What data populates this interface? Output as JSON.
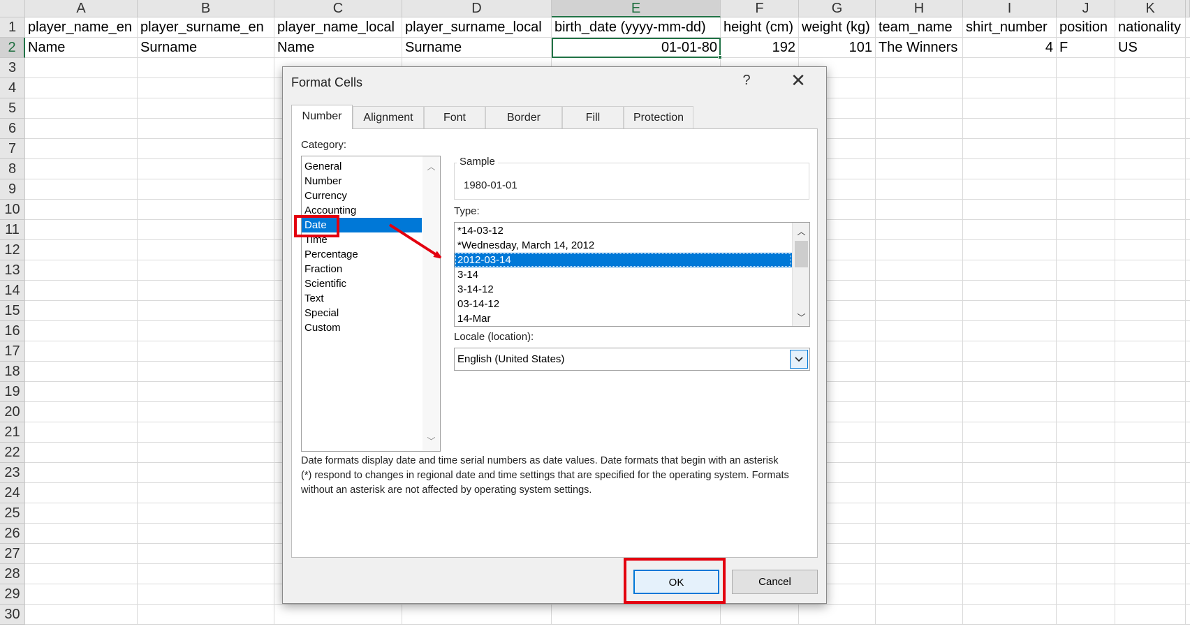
{
  "sheet": {
    "columns": [
      "A",
      "B",
      "C",
      "D",
      "E",
      "F",
      "G",
      "H",
      "I",
      "J",
      "K"
    ],
    "rows": [
      "1",
      "2",
      "3",
      "4",
      "5",
      "6",
      "7",
      "8",
      "9",
      "10",
      "11",
      "12",
      "13",
      "14",
      "15",
      "16",
      "17",
      "18",
      "19",
      "20",
      "21",
      "22",
      "23",
      "24",
      "25",
      "26",
      "27",
      "28",
      "29",
      "30"
    ],
    "header_row": [
      "player_name_en",
      "player_surname_en",
      "player_name_local",
      "player_surname_local",
      "birth_date (yyyy-mm-dd)",
      "height (cm)",
      "weight (kg)",
      "team_name",
      "shirt_number",
      "position",
      "nationality"
    ],
    "data_row": [
      "Name",
      "Surname",
      "Name",
      "Surname",
      "01-01-80",
      "192",
      "101",
      "The Winners",
      "4",
      "F",
      "US"
    ],
    "selected_column": "E",
    "selected_row": "2",
    "accent_color": "#217346"
  },
  "dialog": {
    "title": "Format Cells",
    "help": "?",
    "close": "✕",
    "tabs": [
      "Number",
      "Alignment",
      "Font",
      "Border",
      "Fill",
      "Protection"
    ],
    "active_tab": "Number",
    "category_label": "Category:",
    "categories": [
      "General",
      "Number",
      "Currency",
      "Accounting",
      "Date",
      "Time",
      "Percentage",
      "Fraction",
      "Scientific",
      "Text",
      "Special",
      "Custom"
    ],
    "selected_category": "Date",
    "sample_label": "Sample",
    "sample_value": "1980-01-01",
    "type_label": "Type:",
    "types": [
      "*14-03-12",
      "*Wednesday, March 14, 2012",
      "2012-03-14",
      "3-14",
      "3-14-12",
      "03-14-12",
      "14-Mar"
    ],
    "selected_type": "2012-03-14",
    "locale_label": "Locale (location):",
    "locale_value": "English (United States)",
    "description": "Date formats display date and time serial numbers as date values.  Date formats that begin with an asterisk (*) respond to changes in regional date and time settings that are specified for the operating system. Formats without an asterisk are not affected by operating system settings.",
    "ok_label": "OK",
    "cancel_label": "Cancel",
    "selection_color": "#0078d7"
  },
  "annotation": {
    "highlight_color": "#e3000f"
  }
}
